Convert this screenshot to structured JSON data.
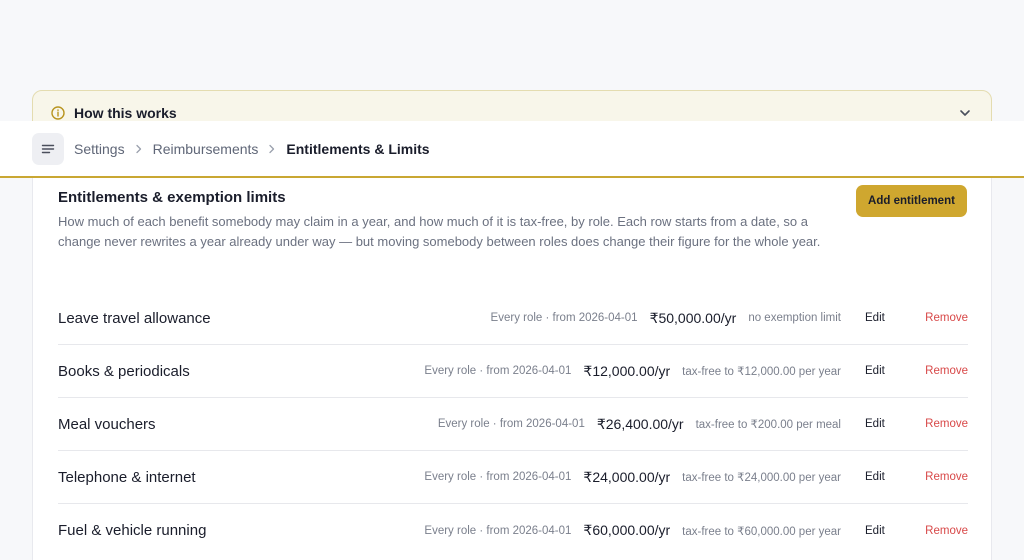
{
  "how_panel": {
    "title": "How this works",
    "info_icon": "info-circle-icon",
    "toggle_icon": "chevron-down-icon"
  },
  "breadcrumb": {
    "menu_icon": "menu-lines-icon",
    "items": [
      "Settings",
      "Reimbursements"
    ],
    "current": "Entitlements & Limits"
  },
  "card": {
    "title": "Entitlements & exemption limits",
    "description": "How much of each benefit somebody may claim in a year, and how much of it is tax-free, by role. Each row starts from a date, so a change never rewrites a year already under way — but moving somebody between roles does change their figure for the whole year.",
    "add_label": "Add entitlement"
  },
  "rows": [
    {
      "name": "Leave travel allowance",
      "meta": "Every role · from 2026-04-01",
      "amount": "₹50,000.00/yr",
      "limit": "no exemption limit",
      "edit": "Edit",
      "remove": "Remove"
    },
    {
      "name": "Books & periodicals",
      "meta": "Every role · from 2026-04-01",
      "amount": "₹12,000.00/yr",
      "limit": "tax-free to ₹12,000.00 per year",
      "edit": "Edit",
      "remove": "Remove"
    },
    {
      "name": "Meal vouchers",
      "meta": "Every role · from 2026-04-01",
      "amount": "₹26,400.00/yr",
      "limit": "tax-free to ₹200.00 per meal",
      "edit": "Edit",
      "remove": "Remove"
    },
    {
      "name": "Telephone & internet",
      "meta": "Every role · from 2026-04-01",
      "amount": "₹24,000.00/yr",
      "limit": "tax-free to ₹24,000.00 per year",
      "edit": "Edit",
      "remove": "Remove"
    },
    {
      "name": "Fuel & vehicle running",
      "meta": "Every role · from 2026-04-01",
      "amount": "₹60,000.00/yr",
      "limit": "tax-free to ₹60,000.00 per year",
      "edit": "Edit",
      "remove": "Remove"
    }
  ],
  "colors": {
    "accent": "#cfa72f",
    "danger": "#d84848",
    "panel_bg": "#f8f6ea"
  }
}
